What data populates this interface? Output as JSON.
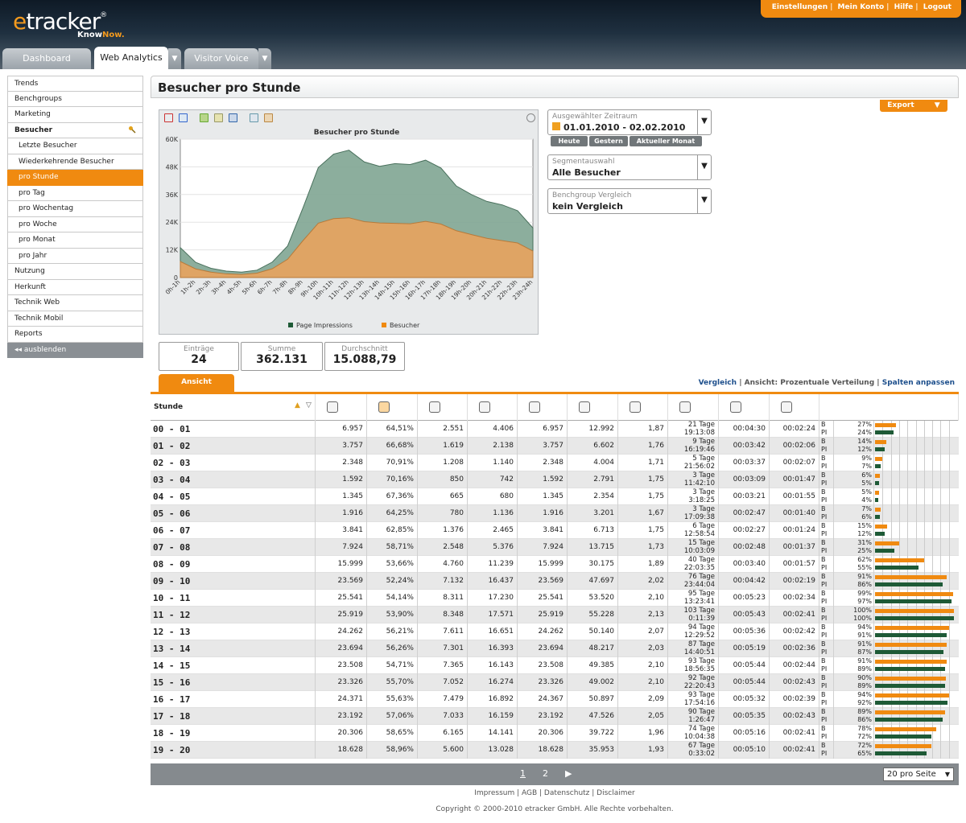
{
  "brand": {
    "name": "etracker",
    "reg": "®",
    "tagline_a": "Know",
    "tagline_b": "Now."
  },
  "toplinks": [
    "Einstellungen",
    "Mein Konto",
    "Hilfe",
    "Logout"
  ],
  "tabs": [
    "Dashboard",
    "Web Analytics",
    "Visitor Voice"
  ],
  "sidebar": {
    "items": [
      "Trends",
      "Benchgroups",
      "Marketing",
      "Besucher",
      "Letzte Besucher",
      "Wiederkehrende Besucher",
      "pro Stunde",
      "pro Tag",
      "pro Wochentag",
      "pro Woche",
      "pro Monat",
      "pro Jahr",
      "Nutzung",
      "Herkunft",
      "Technik Web",
      "Technik Mobil",
      "Reports",
      "ausblenden"
    ]
  },
  "page": {
    "title": "Besucher pro Stunde",
    "export": "Export"
  },
  "controls": {
    "zeitraum_label": "Ausgewählter Zeitraum",
    "zeitraum_value": "01.01.2010 - 02.02.2010",
    "quick": [
      "Heute",
      "Gestern",
      "Aktueller Monat"
    ],
    "segment_label": "Segmentauswahl",
    "segment_value": "Alle Besucher",
    "bench_label": "Benchgroup Vergleich",
    "bench_value": "kein Vergleich"
  },
  "stats": {
    "eintraege_label": "Einträge",
    "eintraege": "24",
    "summe_label": "Summe",
    "summe": "362.131",
    "durchschnitt_label": "Durchschnitt",
    "durchschnitt": "15.088,79"
  },
  "view": {
    "tab": "Ansicht",
    "link1": "Vergleich",
    "sep1": "|",
    "link2_prefix": "Ansicht:",
    "link2": "Prozentuale Verteilung",
    "sep2": "|",
    "link3": "Spalten anpassen"
  },
  "table": {
    "col_stunde": "Stunde",
    "rows": [
      [
        "00 - 01",
        "6.957",
        "64,51%",
        "2.551",
        "4.406",
        "6.957",
        "12.992",
        "1,87",
        "21 Tage",
        "19:13:08",
        "00:04:30",
        "00:02:24",
        "27%",
        "24%"
      ],
      [
        "01 - 02",
        "3.757",
        "66,68%",
        "1.619",
        "2.138",
        "3.757",
        "6.602",
        "1,76",
        "9 Tage",
        "16:19:46",
        "00:03:42",
        "00:02:06",
        "14%",
        "12%"
      ],
      [
        "02 - 03",
        "2.348",
        "70,91%",
        "1.208",
        "1.140",
        "2.348",
        "4.004",
        "1,71",
        "5 Tage",
        "21:56:02",
        "00:03:37",
        "00:02:07",
        "9%",
        "7%"
      ],
      [
        "03 - 04",
        "1.592",
        "70,16%",
        "850",
        "742",
        "1.592",
        "2.791",
        "1,75",
        "3 Tage",
        "11:42:10",
        "00:03:09",
        "00:01:47",
        "6%",
        "5%"
      ],
      [
        "04 - 05",
        "1.345",
        "67,36%",
        "665",
        "680",
        "1.345",
        "2.354",
        "1,75",
        "3 Tage",
        "3:18:25",
        "00:03:21",
        "00:01:55",
        "5%",
        "4%"
      ],
      [
        "05 - 06",
        "1.916",
        "64,25%",
        "780",
        "1.136",
        "1.916",
        "3.201",
        "1,67",
        "3 Tage",
        "17:09:38",
        "00:02:47",
        "00:01:40",
        "7%",
        "6%"
      ],
      [
        "06 - 07",
        "3.841",
        "62,85%",
        "1.376",
        "2.465",
        "3.841",
        "6.713",
        "1,75",
        "6 Tage",
        "12:58:54",
        "00:02:27",
        "00:01:24",
        "15%",
        "12%"
      ],
      [
        "07 - 08",
        "7.924",
        "58,71%",
        "2.548",
        "5.376",
        "7.924",
        "13.715",
        "1,73",
        "15 Tage",
        "10:03:09",
        "00:02:48",
        "00:01:37",
        "31%",
        "25%"
      ],
      [
        "08 - 09",
        "15.999",
        "53,66%",
        "4.760",
        "11.239",
        "15.999",
        "30.175",
        "1,89",
        "40 Tage",
        "22:03:35",
        "00:03:40",
        "00:01:57",
        "62%",
        "55%"
      ],
      [
        "09 - 10",
        "23.569",
        "52,24%",
        "7.132",
        "16.437",
        "23.569",
        "47.697",
        "2,02",
        "76 Tage",
        "23:44:04",
        "00:04:42",
        "00:02:19",
        "91%",
        "86%"
      ],
      [
        "10 - 11",
        "25.541",
        "54,14%",
        "8.311",
        "17.230",
        "25.541",
        "53.520",
        "2,10",
        "95 Tage",
        "13:23:41",
        "00:05:23",
        "00:02:34",
        "99%",
        "97%"
      ],
      [
        "11 - 12",
        "25.919",
        "53,90%",
        "8.348",
        "17.571",
        "25.919",
        "55.228",
        "2,13",
        "103 Tage",
        "0:11:39",
        "00:05:43",
        "00:02:41",
        "100%",
        "100%"
      ],
      [
        "12 - 13",
        "24.262",
        "56,21%",
        "7.611",
        "16.651",
        "24.262",
        "50.140",
        "2,07",
        "94 Tage",
        "12:29:52",
        "00:05:36",
        "00:02:42",
        "94%",
        "91%"
      ],
      [
        "13 - 14",
        "23.694",
        "56,26%",
        "7.301",
        "16.393",
        "23.694",
        "48.217",
        "2,03",
        "87 Tage",
        "14:40:51",
        "00:05:19",
        "00:02:36",
        "91%",
        "87%"
      ],
      [
        "14 - 15",
        "23.508",
        "54,71%",
        "7.365",
        "16.143",
        "23.508",
        "49.385",
        "2,10",
        "93 Tage",
        "18:56:35",
        "00:05:44",
        "00:02:44",
        "91%",
        "89%"
      ],
      [
        "15 - 16",
        "23.326",
        "55,70%",
        "7.052",
        "16.274",
        "23.326",
        "49.002",
        "2,10",
        "92 Tage",
        "22:20:43",
        "00:05:44",
        "00:02:43",
        "90%",
        "89%"
      ],
      [
        "16 - 17",
        "24.371",
        "55,63%",
        "7.479",
        "16.892",
        "24.367",
        "50.897",
        "2,09",
        "93 Tage",
        "17:54:16",
        "00:05:32",
        "00:02:39",
        "94%",
        "92%"
      ],
      [
        "17 - 18",
        "23.192",
        "57,06%",
        "7.033",
        "16.159",
        "23.192",
        "47.526",
        "2,05",
        "90 Tage",
        "1:26:47",
        "00:05:35",
        "00:02:43",
        "89%",
        "86%"
      ],
      [
        "18 - 19",
        "20.306",
        "58,65%",
        "6.165",
        "14.141",
        "20.306",
        "39.722",
        "1,96",
        "74 Tage",
        "10:04:38",
        "00:05:16",
        "00:02:41",
        "78%",
        "72%"
      ],
      [
        "19 - 20",
        "18.628",
        "58,96%",
        "5.600",
        "13.028",
        "18.628",
        "35.953",
        "1,93",
        "67 Tage",
        "0:33:02",
        "00:05:10",
        "00:02:41",
        "72%",
        "65%"
      ]
    ],
    "b_label": "B",
    "pi_label": "PI"
  },
  "pager": {
    "p1": "1",
    "p2": "2",
    "next": "▶",
    "perpage": "20 pro Seite"
  },
  "footer": {
    "links": "Impressum | AGB | Datenschutz | Disclaimer",
    "copyright": "Copyright © 2000-2010 etracker GmbH. Alle Rechte vorbehalten."
  },
  "colors": {
    "orange": "#f08a10",
    "green": "#1e5a36",
    "pi_area": "#7fa592",
    "visitor_area": "#e8a35e"
  },
  "chart_data": {
    "type": "area",
    "title": "Besucher pro Stunde",
    "categories": [
      "0h-1h",
      "1h-2h",
      "2h-3h",
      "3h-4h",
      "4h-5h",
      "5h-6h",
      "6h-7h",
      "7h-8h",
      "8h-9h",
      "9h-10h",
      "10h-11h",
      "11h-12h",
      "12h-13h",
      "13h-14h",
      "14h-15h",
      "15h-16h",
      "16h-17h",
      "17h-18h",
      "18h-19h",
      "19h-20h",
      "20h-21h",
      "21h-22h",
      "22h-23h",
      "23h-24h"
    ],
    "series": [
      {
        "name": "Page Impressions",
        "color": "#7fa592",
        "values": [
          12992,
          6602,
          4004,
          2791,
          2354,
          3201,
          6713,
          13715,
          30175,
          47697,
          53520,
          55228,
          50140,
          48217,
          49385,
          49002,
          50897,
          47526,
          39722,
          35953,
          33000,
          31500,
          29000,
          21500
        ]
      },
      {
        "name": "Besucher",
        "color": "#e8a35e",
        "values": [
          6957,
          3757,
          2348,
          1592,
          1345,
          1916,
          3841,
          7924,
          15999,
          23569,
          25541,
          25919,
          24262,
          23694,
          23508,
          23326,
          24371,
          23192,
          20306,
          18628,
          17000,
          16000,
          15000,
          11500
        ]
      }
    ],
    "yticks": [
      "0",
      "12K",
      "24K",
      "36K",
      "48K",
      "60K"
    ],
    "ylim": [
      0,
      60000
    ],
    "legend": "bottom"
  }
}
